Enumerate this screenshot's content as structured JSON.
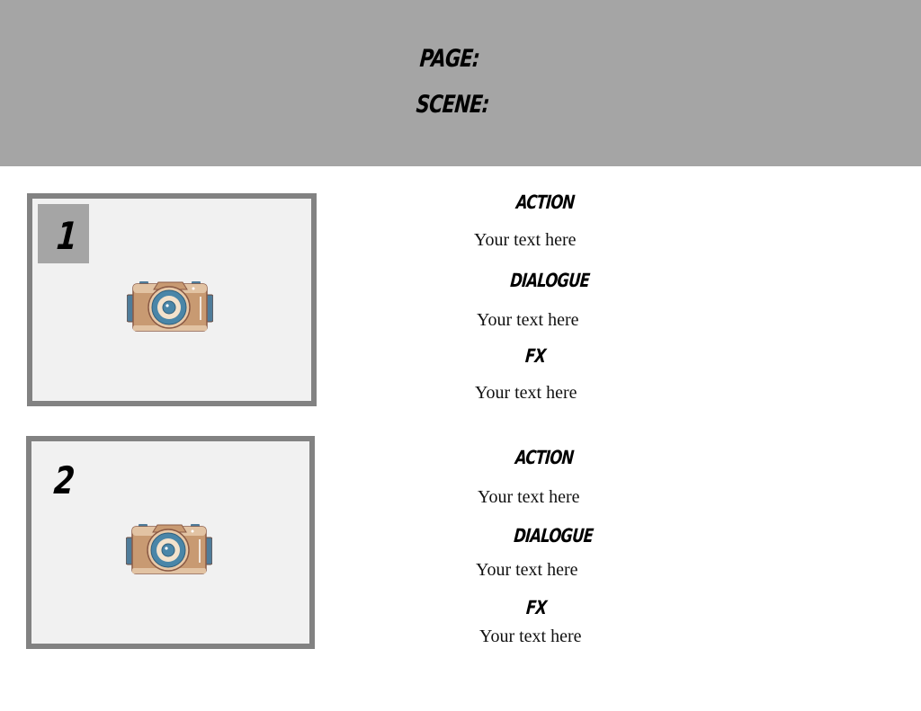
{
  "header": {
    "page_label": "Page:",
    "scene_label": "Scene:",
    "background": "#a5a5a5"
  },
  "panels": [
    {
      "number": "1",
      "image_icon": "camera-icon",
      "notes": [
        {
          "heading": "Action",
          "text": "Your text here"
        },
        {
          "heading": "Dialogue",
          "text": "Your text here"
        },
        {
          "heading": "FX",
          "text": "Your text here"
        }
      ]
    },
    {
      "number": "2",
      "image_icon": "camera-icon",
      "notes": [
        {
          "heading": "Action",
          "text": "Your text here"
        },
        {
          "heading": "Dialogue",
          "text": "Your text here"
        },
        {
          "heading": "FX",
          "text": "Your text here"
        }
      ]
    }
  ],
  "colors": {
    "panel_border": "#828282",
    "panel_fill": "#f1f1f1",
    "number_badge": "#a5a5a5",
    "camera_body": "#c89a72",
    "camera_lens": "#4a86a8"
  }
}
